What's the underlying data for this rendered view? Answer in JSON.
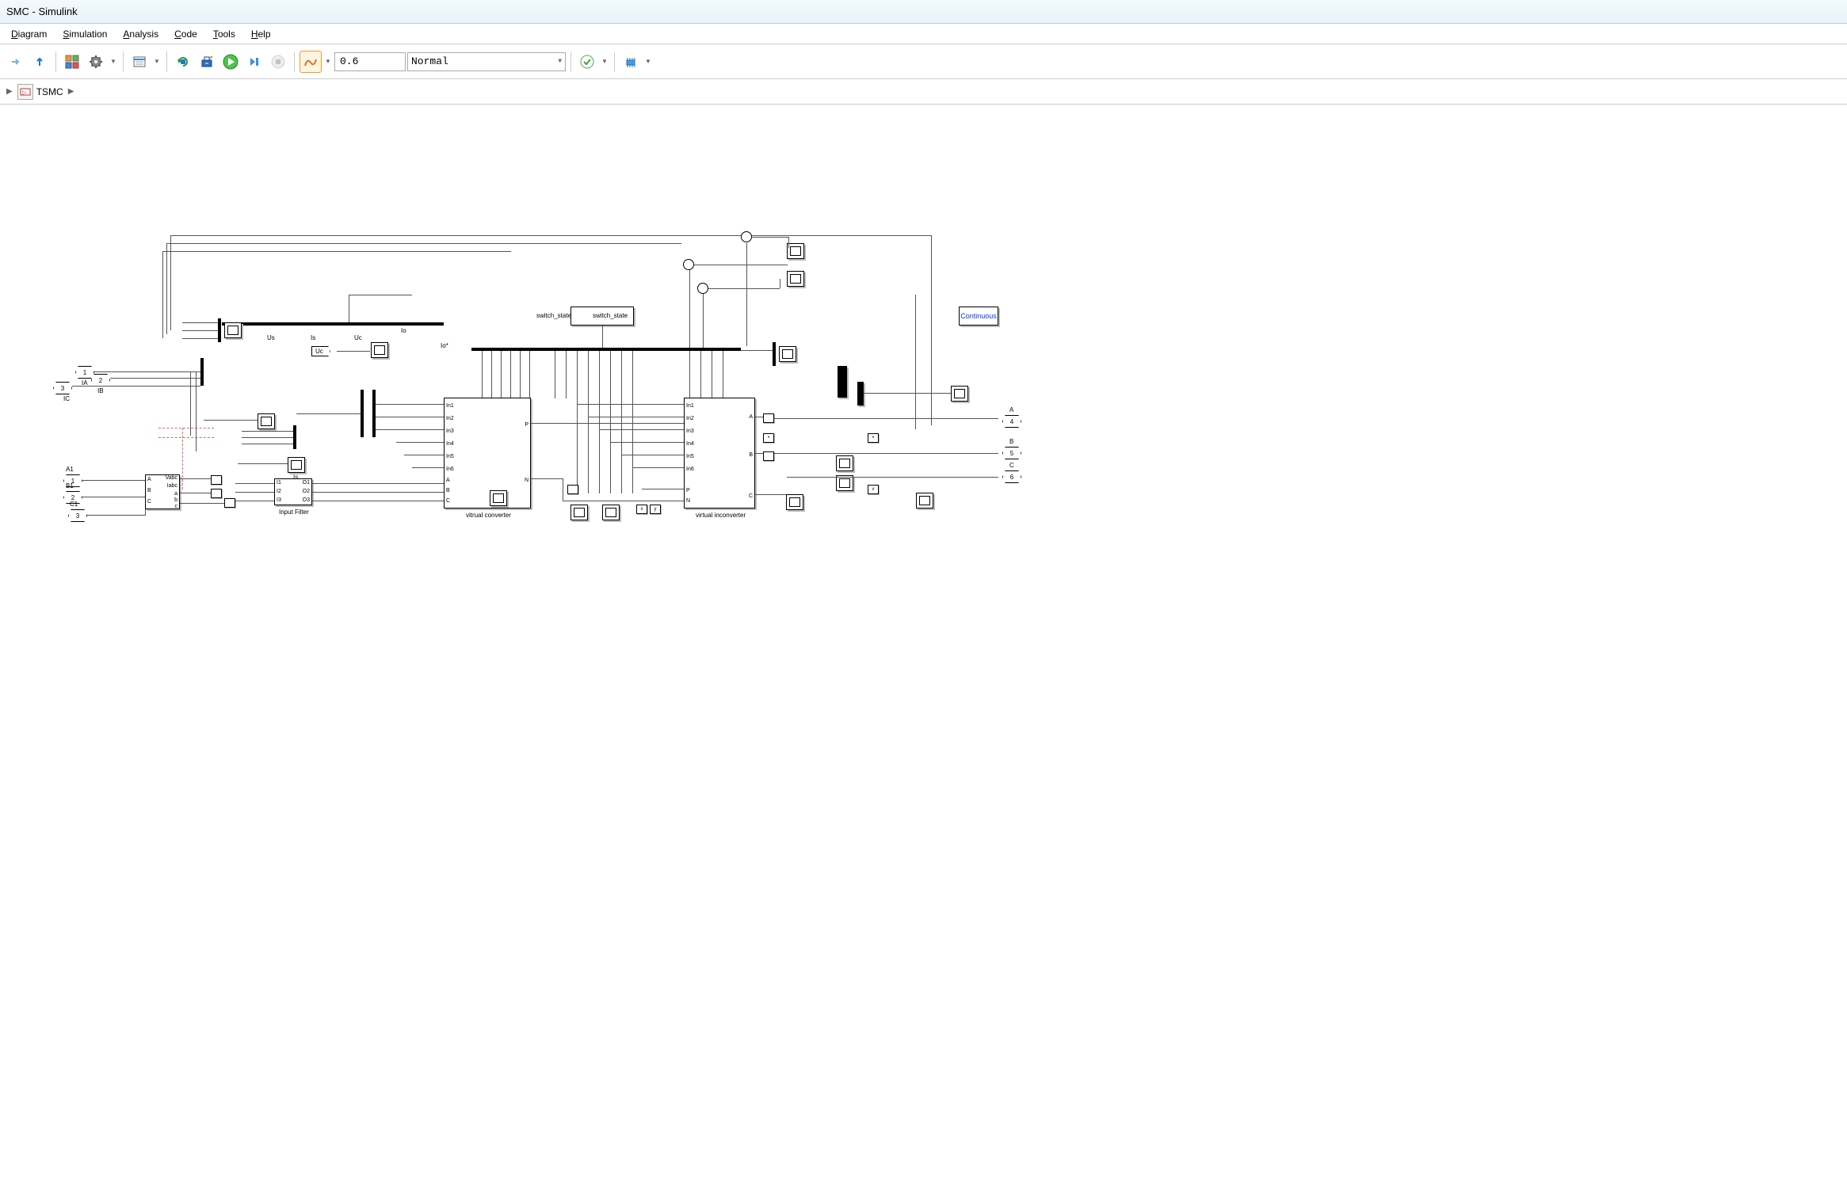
{
  "title": "SMC - Simulink",
  "menubar": {
    "diagram": "Diagram",
    "simulation": "Simulation",
    "analysis": "Analysis",
    "code": "Code",
    "tools": "Tools",
    "help": "Help"
  },
  "toolbar": {
    "stop_time": "0.6",
    "sim_mode": "Normal"
  },
  "breadcrumb": {
    "model": "TSMC"
  },
  "diagram": {
    "powergui": "Continuous",
    "tags": {
      "Uc": "Uc"
    },
    "signals": {
      "Us": "Us",
      "Is": "Is",
      "Uc": "Uc",
      "Io": "Io",
      "Iostar": "Io*"
    },
    "switch_state_in": "switch_state",
    "switch_state_out": "switch_state",
    "inports": {
      "IA": {
        "num": "1",
        "label": "IA"
      },
      "IB": {
        "num": "2",
        "label": "IB"
      },
      "IC": {
        "num": "3",
        "label": "IC"
      },
      "A1": {
        "num": "1",
        "label": "A1"
      },
      "B1": {
        "num": "2",
        "label": "B1"
      },
      "C1": {
        "num": "3",
        "label": "C1"
      }
    },
    "outports": {
      "A": {
        "num": "4",
        "label": "A"
      },
      "B": {
        "num": "5",
        "label": "B"
      },
      "C": {
        "num": "6",
        "label": "C"
      }
    },
    "meas_block": {
      "A": "A",
      "B": "B",
      "C": "C",
      "Vabc": "Vabc",
      "Iabc": "Iabc",
      "a": "a",
      "b": "b",
      "c": "c"
    },
    "input_filter": {
      "label": "Input Filter",
      "I1": "I1",
      "I2": "I2",
      "I3": "I3",
      "O1": "O1",
      "O2": "O2",
      "O3": "O3"
    },
    "vconv": {
      "label": "vitrual converter",
      "In1": "In1",
      "In2": "In2",
      "In3": "In3",
      "In4": "In4",
      "In5": "In5",
      "In6": "In6",
      "A": "A",
      "B": "B",
      "C": "C",
      "P": "P",
      "N": "N"
    },
    "vinv": {
      "label": "virtual inconverter",
      "In1": "In1",
      "In2": "In2",
      "In3": "In3",
      "In4": "In4",
      "In5": "In5",
      "In6": "In6",
      "P": "P",
      "N": "N",
      "A": "A",
      "B": "B",
      "C": "C"
    },
    "Is_label": "Is"
  }
}
